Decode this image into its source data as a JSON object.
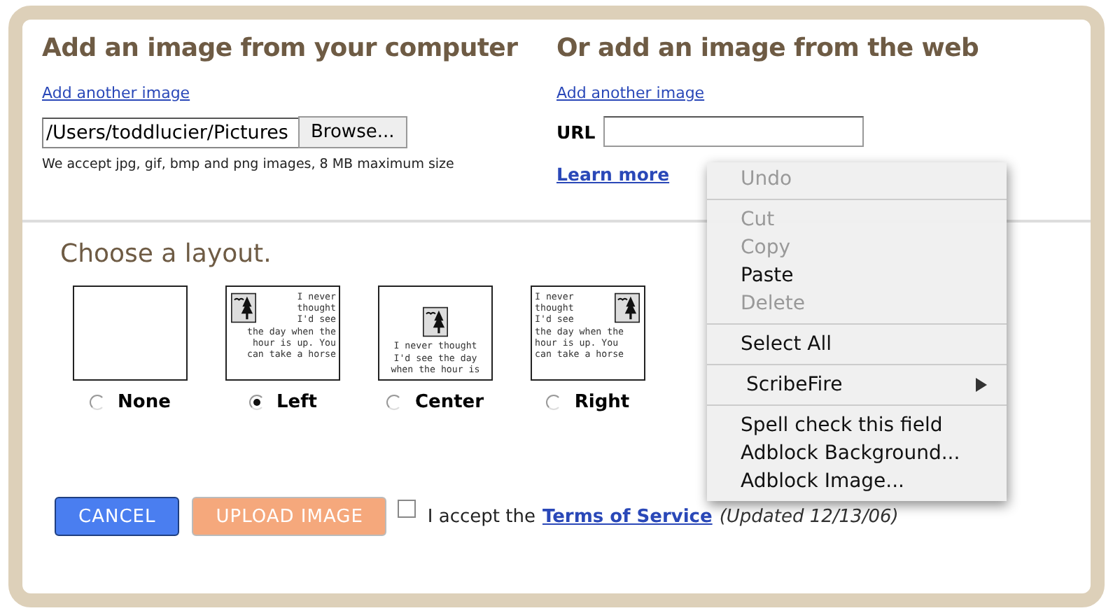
{
  "computer_upload": {
    "heading": "Add an image from your computer",
    "add_link": "Add another image",
    "file_value": "/Users/toddlucier/Pictures",
    "browse_button": "Browse...",
    "note": "We accept jpg, gif, bmp and png images, 8 MB maximum size"
  },
  "web_upload": {
    "heading": "Or add an image from the web",
    "add_link": "Add another image",
    "url_label": "URL",
    "learn_link": "Learn more"
  },
  "layout": {
    "heading": "Choose a layout.",
    "options": [
      {
        "kind": "none",
        "label": "None",
        "selected": false
      },
      {
        "kind": "left",
        "label": "Left",
        "selected": true,
        "lines": [
          "I never",
          "thought",
          "I'd see",
          "the day when the",
          "hour is up. You",
          "can take a horse"
        ]
      },
      {
        "kind": "center",
        "label": "Center",
        "selected": false,
        "lines": [
          "I never thought",
          "I'd see the day",
          "when the hour is"
        ]
      },
      {
        "kind": "right",
        "label": "Right",
        "selected": false,
        "lines": [
          "I never",
          "thought",
          "I'd see",
          "the day when the",
          "hour is up. You",
          "can take a horse"
        ]
      }
    ]
  },
  "buttons": {
    "cancel": "CANCEL",
    "upload": "UPLOAD IMAGE",
    "upload_disabled": true
  },
  "terms": {
    "checked": false,
    "prefix": "I accept the",
    "link": "Terms of Service",
    "note": "(Updated 12/13/06)"
  },
  "context_menu": [
    {
      "kind": "item",
      "label": "Undo",
      "disabled": true
    },
    {
      "kind": "separator"
    },
    {
      "kind": "item",
      "label": "Cut",
      "disabled": true
    },
    {
      "kind": "item",
      "label": "Copy",
      "disabled": true
    },
    {
      "kind": "item",
      "label": "Paste",
      "disabled": false
    },
    {
      "kind": "item",
      "label": "Delete",
      "disabled": true
    },
    {
      "kind": "separator"
    },
    {
      "kind": "item",
      "label": "Select All",
      "disabled": false
    },
    {
      "kind": "separator"
    },
    {
      "kind": "submenu",
      "label": "ScribeFire",
      "disabled": false
    },
    {
      "kind": "separator"
    },
    {
      "kind": "item",
      "label": "Spell check this field",
      "disabled": false
    },
    {
      "kind": "item",
      "label": "Adblock Background...",
      "disabled": false
    },
    {
      "kind": "item",
      "label": "Adblock Image...",
      "disabled": false
    }
  ]
}
